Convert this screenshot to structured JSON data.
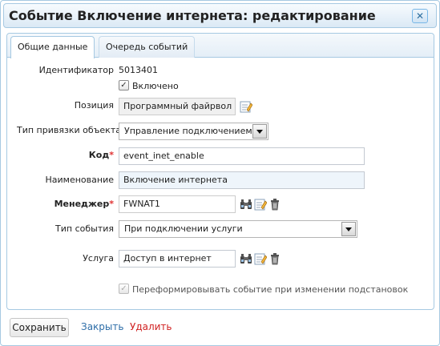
{
  "dialog": {
    "title": "Событие Включение интернета: редактирование",
    "close_symbol": "✕"
  },
  "tabs": [
    {
      "label": "Общие данные",
      "active": true
    },
    {
      "label": "Очередь событий",
      "active": false
    }
  ],
  "form": {
    "id_label": "Идентификатор",
    "id_value": "5013401",
    "enabled_label": "Включено",
    "enabled_checked": true,
    "position_label": "Позиция",
    "position_value": "Программный файрвол",
    "binding_type_label": "Тип привязки объекта",
    "binding_type_value": "Управление подключением",
    "code_label": "Код",
    "code_value": "event_inet_enable",
    "name_label": "Наименование",
    "name_value": "Включение интернета",
    "manager_label": "Менеджер",
    "manager_value": "FWNAT1",
    "event_type_label": "Тип события",
    "event_type_value": "При подключении услуги",
    "service_label": "Услуга",
    "service_value": "Доступ в интернет",
    "reform_label": "Переформировывать событие при изменении подстановок",
    "reform_checked": true,
    "required_mark": "*"
  },
  "footer": {
    "save_label": "Сохранить",
    "close_label": "Закрыть",
    "delete_label": "Удалить"
  },
  "colors": {
    "accent_border": "#a6c9e2",
    "link_blue": "#2e6ea8",
    "link_red": "#d02020",
    "required_star": "#e03030"
  },
  "icons": {
    "binoculars": "binoculars-icon",
    "edit": "edit-icon",
    "trash": "trash-icon"
  }
}
